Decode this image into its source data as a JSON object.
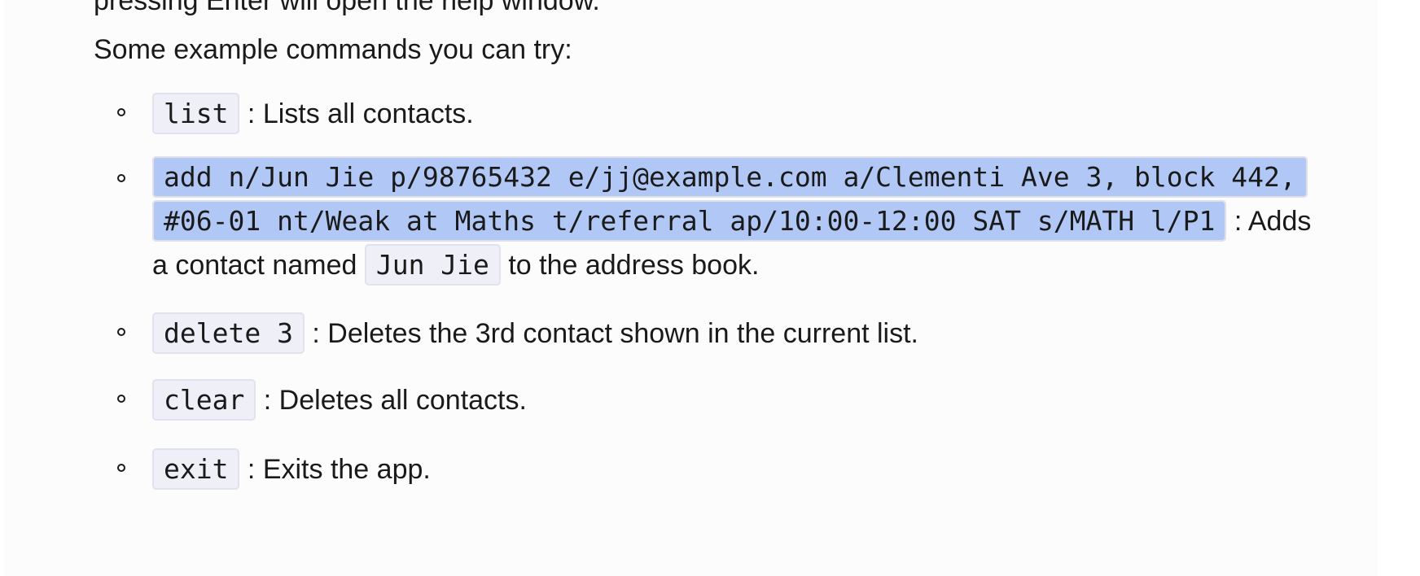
{
  "doc": {
    "clipped_line": "pressing Enter will open the help window.",
    "intro": "Some example commands you can try:",
    "items": [
      {
        "code": "list",
        "desc": " : Lists all contacts."
      },
      {
        "code": "add n/Jun Jie p/98765432 e/jj@example.com a/Clementi Ave 3, block 442, #06-01 nt/Weak at Maths t/referral ap/10:00-12:00 SAT s/MATH l/P1",
        "desc_before": " : Adds a contact named ",
        "code2": "Jun Jie",
        "desc_after": " to the address book."
      },
      {
        "code": "delete 3",
        "desc": " : Deletes the 3rd contact shown in the current list."
      },
      {
        "code": "clear",
        "desc": " : Deletes all contacts."
      },
      {
        "code": "exit",
        "desc": " : Exits the app."
      }
    ]
  }
}
